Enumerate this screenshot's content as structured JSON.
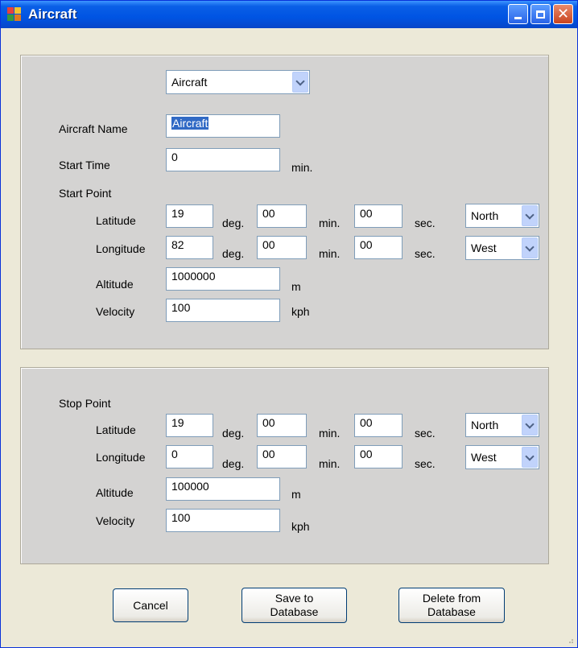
{
  "window": {
    "title": "Aircraft"
  },
  "aircraft_type": {
    "selected": "Aircraft"
  },
  "aircraft_name": {
    "label": "Aircraft Name",
    "value": "Aircraft"
  },
  "start_time": {
    "label": "Start Time",
    "value": "0",
    "unit": "min."
  },
  "start_point": {
    "heading": "Start Point",
    "latitude": {
      "label": "Latitude",
      "deg": "19",
      "min": "00",
      "sec": "00",
      "hemisphere": "North"
    },
    "longitude": {
      "label": "Longitude",
      "deg": "82",
      "min": "00",
      "sec": "00",
      "hemisphere": "West"
    },
    "altitude": {
      "label": "Altitude",
      "value": "1000000",
      "unit": "m"
    },
    "velocity": {
      "label": "Velocity",
      "value": "100",
      "unit": "kph"
    }
  },
  "stop_point": {
    "heading": "Stop Point",
    "latitude": {
      "label": "Latitude",
      "deg": "19",
      "min": "00",
      "sec": "00",
      "hemisphere": "North"
    },
    "longitude": {
      "label": "Longitude",
      "deg": "0",
      "min": "00",
      "sec": "00",
      "hemisphere": "West"
    },
    "altitude": {
      "label": "Altitude",
      "value": "100000",
      "unit": "m"
    },
    "velocity": {
      "label": "Velocity",
      "value": "100",
      "unit": "kph"
    }
  },
  "units": {
    "deg": "deg.",
    "min": "min.",
    "sec": "sec."
  },
  "buttons": {
    "cancel": "Cancel",
    "save_line1": "Save to",
    "save_line2": "Database",
    "delete_line1": "Delete from",
    "delete_line2": "Database"
  }
}
